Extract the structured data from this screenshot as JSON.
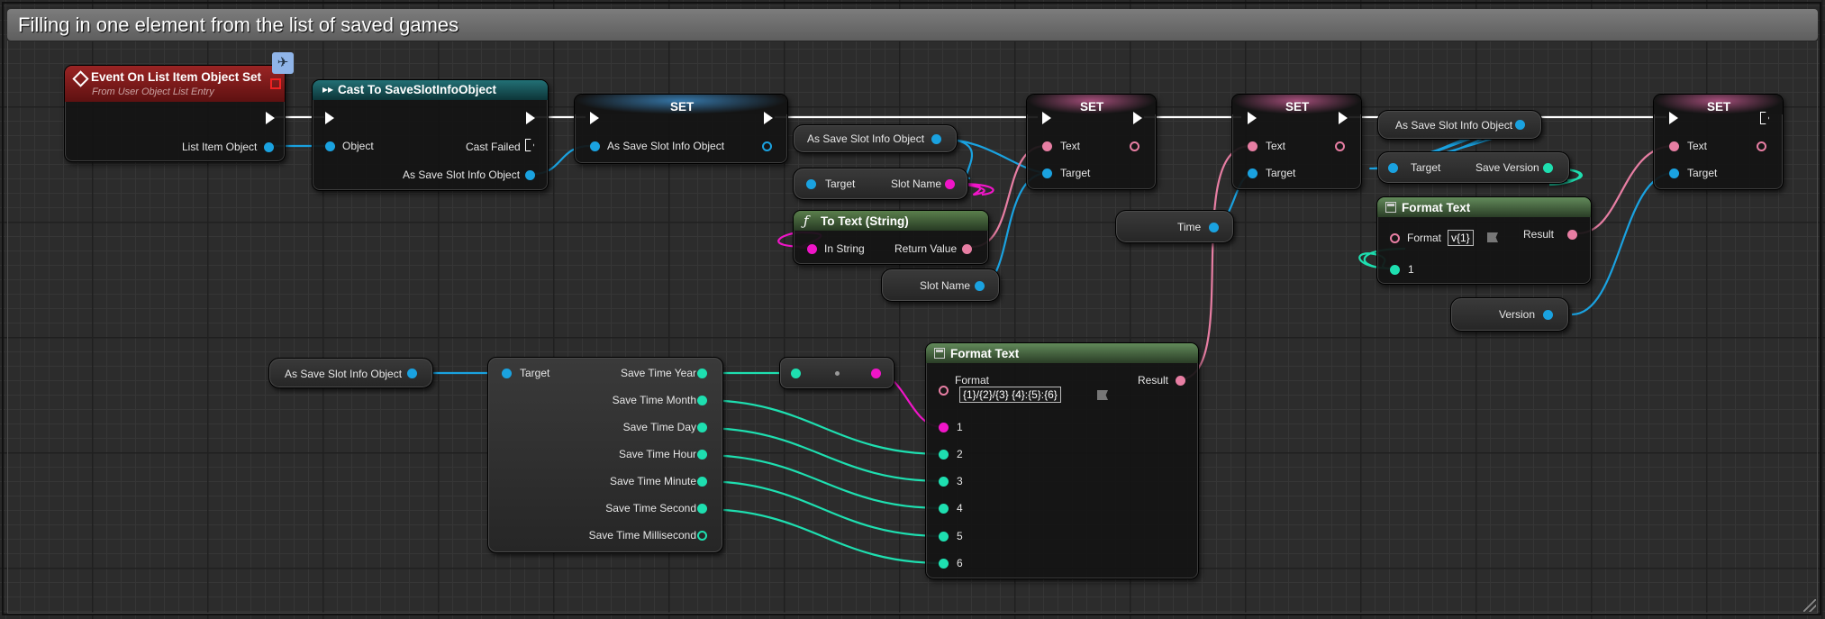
{
  "comment": {
    "title": "Filling in one element from the list of saved games"
  },
  "colors": {
    "exec": "#ffffff",
    "object": "#1aa2e0",
    "text": "#e77ea3",
    "string": "#f015c8",
    "integer": "#1edfb0",
    "event_header": "#7e1a1a",
    "cast_header": "#1a5558",
    "set_header": "#3a5a72",
    "func_header": "#4a6a40",
    "format_header": "#5a7f55"
  },
  "event_node": {
    "title": "Event On List Item Object Set",
    "subtitle": "From User Object List Entry",
    "pin_out": "List Item Object",
    "icon": "event-diamond-icon",
    "badge_icon": "network-replicated-icon"
  },
  "cast_node": {
    "title": "Cast To SaveSlotInfoObject",
    "pin_object": "Object",
    "pin_cast_failed": "Cast Failed",
    "pin_out": "As Save Slot Info Object",
    "icon": "cast-arrow-icon"
  },
  "set_node_1": {
    "title": "SET",
    "pin_in": "As Save Slot Info Object"
  },
  "var_as_save_slot_top": {
    "label": "As Save Slot Info Object"
  },
  "get_slot_name": {
    "pin_target": "Target",
    "pin_out": "Slot Name"
  },
  "to_text_node": {
    "title": "To Text (String)",
    "pin_in": "In String",
    "pin_out": "Return Value",
    "icon": "function-f-icon"
  },
  "var_slot_name": {
    "label": "Slot Name"
  },
  "set_node_2": {
    "title": "SET",
    "pin_text": "Text",
    "pin_target": "Target"
  },
  "var_time": {
    "label": "Time"
  },
  "set_node_3": {
    "title": "SET",
    "pin_text": "Text",
    "pin_target": "Target"
  },
  "var_as_save_slot_right": {
    "label": "As Save Slot Info Object"
  },
  "get_save_version": {
    "pin_target": "Target",
    "pin_out": "Save Version"
  },
  "format_version_node": {
    "title": "Format Text",
    "pin_format": "Format",
    "format_value": "v{1}",
    "pin_1": "1",
    "pin_result": "Result",
    "icon": "format-text-icon"
  },
  "var_version": {
    "label": "Version"
  },
  "set_node_4": {
    "title": "SET",
    "pin_text": "Text",
    "pin_target": "Target"
  },
  "var_as_save_slot_bottom": {
    "label": "As Save Slot Info Object"
  },
  "break_time_node": {
    "pin_target": "Target",
    "outputs": [
      "Save Time Year",
      "Save Time Month",
      "Save Time Day",
      "Save Time Hour",
      "Save Time Minute",
      "Save Time Second",
      "Save Time Millisecond"
    ]
  },
  "convert_node": {
    "icon": "conversion-dot-icon"
  },
  "format_time_node": {
    "title": "Format Text",
    "pin_format": "Format",
    "format_value": "{1}/{2}/{3} {4}:{5}:{6}",
    "pin_result": "Result",
    "args": [
      "1",
      "2",
      "3",
      "4",
      "5",
      "6"
    ],
    "icon": "format-text-icon"
  }
}
